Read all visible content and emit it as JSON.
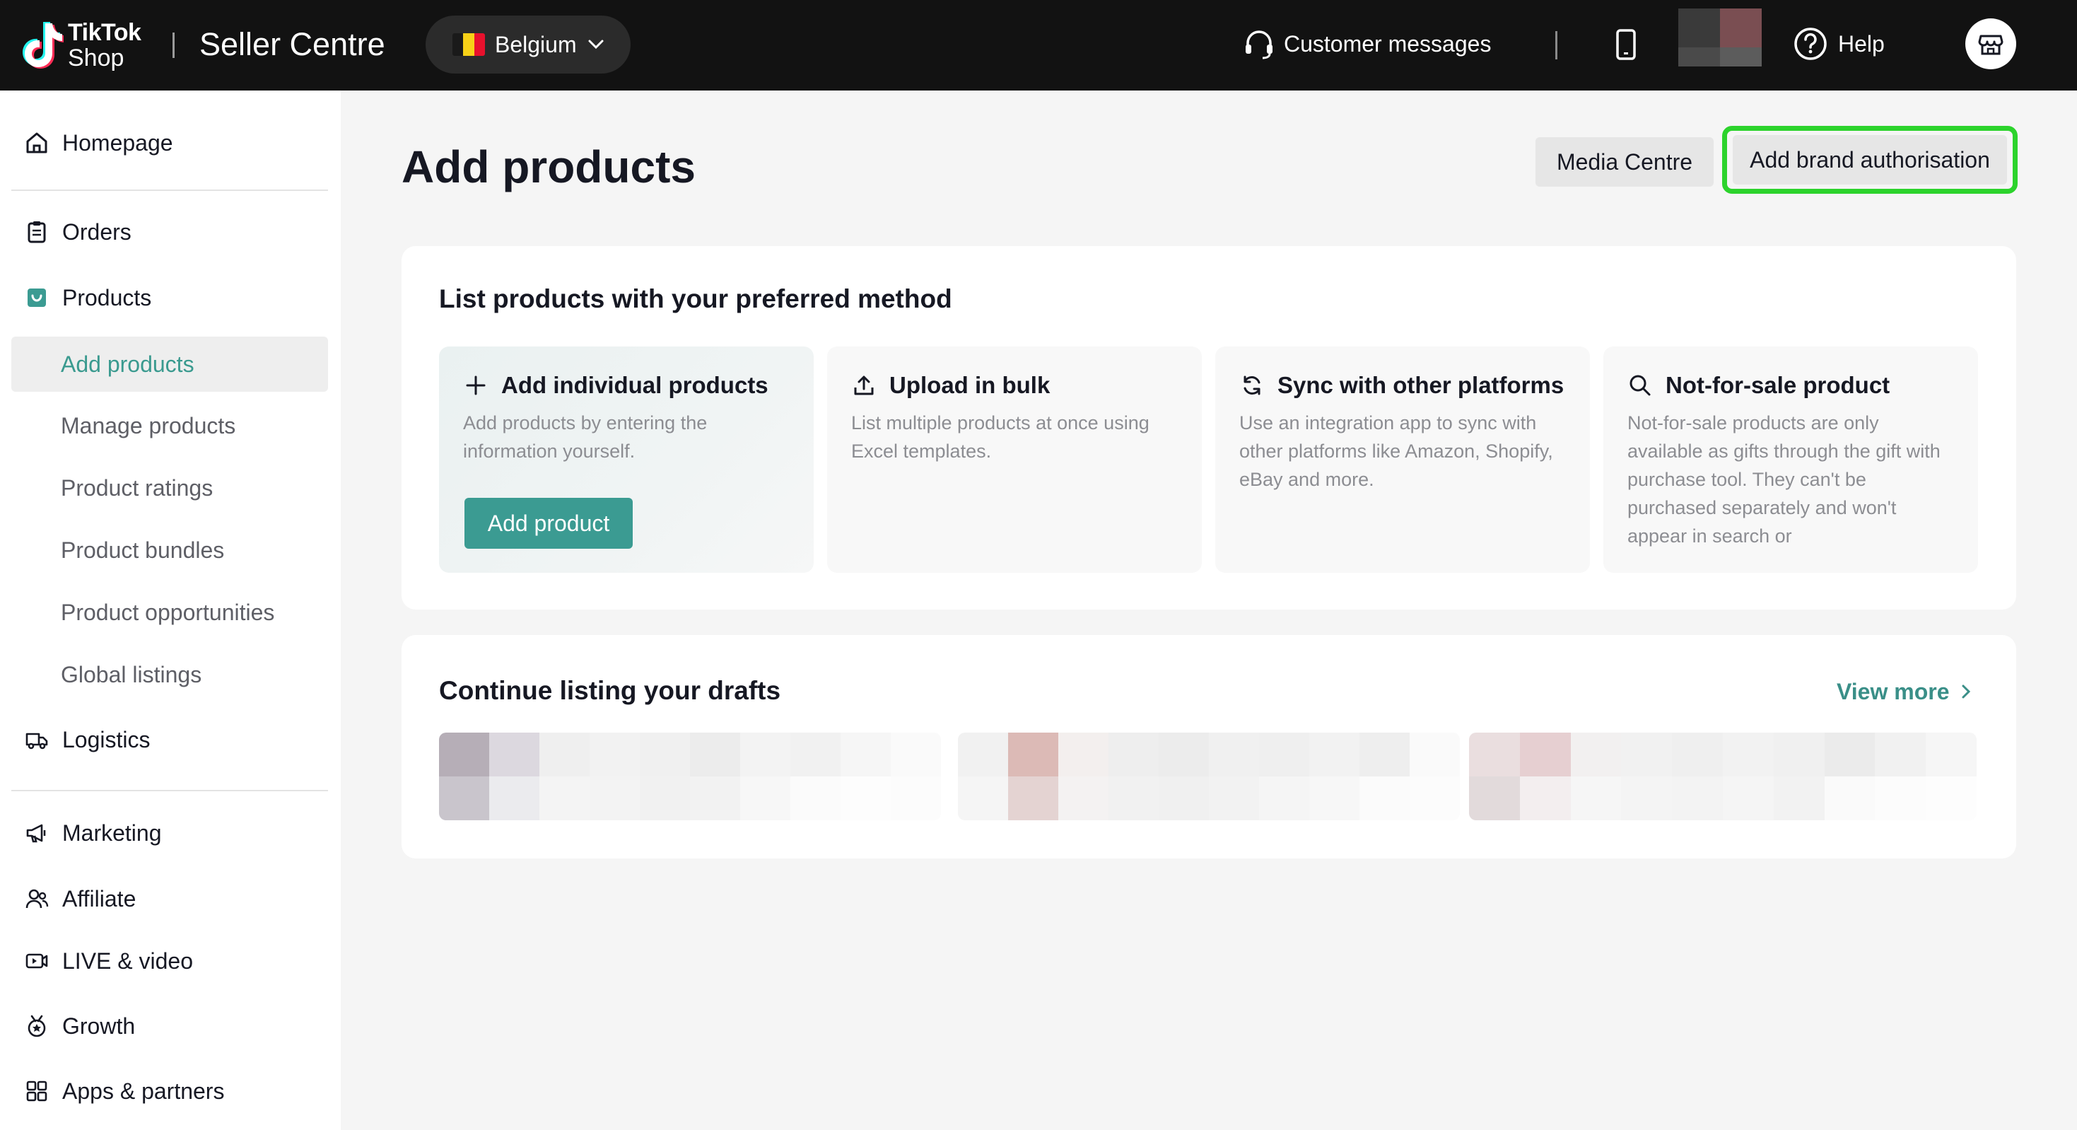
{
  "topbar": {
    "logo_line1": "TikTok",
    "logo_line2": "Shop",
    "app_title": "Seller Centre",
    "region": "Belgium",
    "customer_messages": "Customer messages",
    "help": "Help",
    "flag_colors": [
      "#1a1a1a",
      "#f7d117",
      "#e8112d"
    ]
  },
  "sidebar": {
    "homepage": "Homepage",
    "orders": "Orders",
    "products": "Products",
    "sub": {
      "add_products": "Add products",
      "manage_products": "Manage products",
      "product_ratings": "Product ratings",
      "product_bundles": "Product bundles",
      "product_opportunities": "Product opportunities",
      "global_listings": "Global listings"
    },
    "logistics": "Logistics",
    "marketing": "Marketing",
    "affiliate": "Affiliate",
    "live_video": "LIVE & video",
    "growth": "Growth",
    "apps_partners": "Apps & partners"
  },
  "main": {
    "title": "Add products",
    "media_centre": "Media Centre",
    "add_brand_authorisation": "Add brand authorisation",
    "methods_title": "List products with your preferred method",
    "methods": [
      {
        "title": "Add individual products",
        "desc": "Add products by entering the information yourself.",
        "icon": "plus-icon"
      },
      {
        "title": "Upload in bulk",
        "desc": "List multiple products at once using Excel templates.",
        "icon": "upload-icon"
      },
      {
        "title": "Sync with other platforms",
        "desc": "Use an integration app to sync with other platforms like Amazon, Shopify, eBay and more.",
        "icon": "sync-icon"
      },
      {
        "title": "Not-for-sale product",
        "desc": "Not-for-sale products are only available as gifts through the gift with purchase tool. They can't be purchased separately and won't appear in search or",
        "icon": "search-icon"
      }
    ],
    "add_product_button": "Add product",
    "drafts_title": "Continue listing your drafts",
    "view_more": "View more"
  },
  "colors": {
    "accent": "#3b9b92",
    "highlight": "#2cd32c",
    "topbar": "#121212"
  }
}
